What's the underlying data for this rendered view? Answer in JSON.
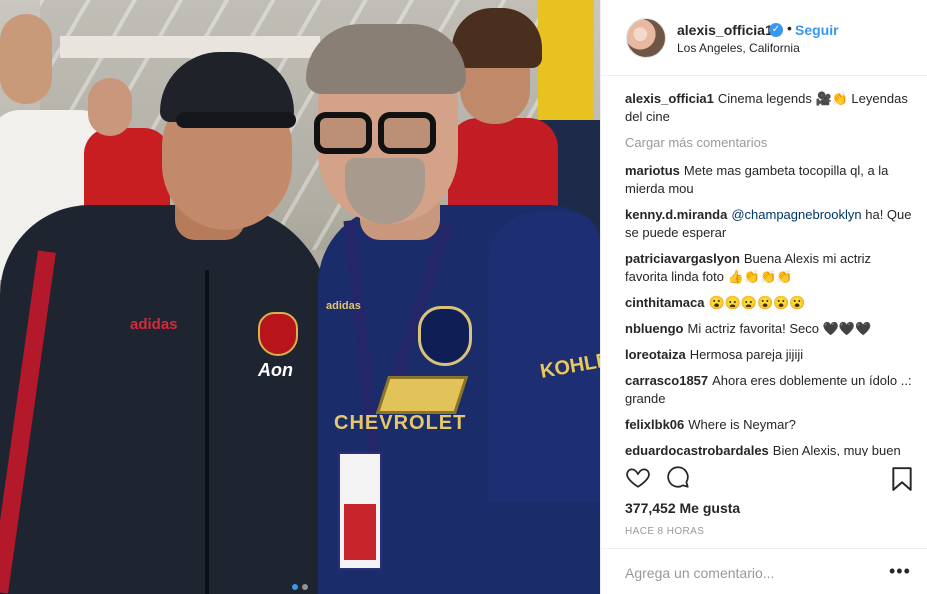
{
  "post": {
    "username": "alexis_officia1",
    "follow_label": "Seguir",
    "separator": "•",
    "location": "Los Angeles, California",
    "verified_mark": "✓"
  },
  "caption": {
    "username": "alexis_officia1",
    "text": "Cinema legends 🎥👏 Leyendas del cine"
  },
  "load_more": "Cargar más comentarios",
  "comments": [
    {
      "username": "mariotus",
      "text": "Mete mas gambeta tocopilla ql, a la mierda mou"
    },
    {
      "username": "kenny.d.miranda",
      "mention": "@champagnebrooklyn",
      "text": "ha! Que se puede esperar"
    },
    {
      "username": "patriciavargaslyon",
      "text": "Buena Alexis mi actriz favorita linda foto 👍👏👏👏"
    },
    {
      "username": "cinthitamaca",
      "text": "😮😦😦😮😮😮"
    },
    {
      "username": "nbluengo",
      "text": "Mi actriz favorita! Seco 🖤🖤🖤"
    },
    {
      "username": "loreotaiza",
      "text": "Hermosa pareja jijiji"
    },
    {
      "username": "carrasco1857",
      "text": "Ahora eres doblemente un ídolo ..: grande"
    },
    {
      "username": "felixlbk06",
      "text": "Where is Neymar?"
    },
    {
      "username": "eduardocastrobardales",
      "text": "Bien Alexis, muy buen partido, este es el inicio de una muy"
    }
  ],
  "likes": "377,452 Me gusta",
  "time": "HACE 8 HORAS",
  "add_comment_placeholder": "Agrega un comentario...",
  "more_label": "•••",
  "photo_text": {
    "adidas_left": "adidas",
    "aon": "Aon",
    "adidas_right": "adidas",
    "chevrolet": "CHEVROLET",
    "kohler": "KOHLE"
  },
  "colors": {
    "accent": "#3897f0",
    "text": "#262626",
    "muted": "#999999"
  },
  "icons": [
    "heart-icon",
    "comment-icon",
    "bookmark-icon",
    "more-icon",
    "verified-icon"
  ]
}
